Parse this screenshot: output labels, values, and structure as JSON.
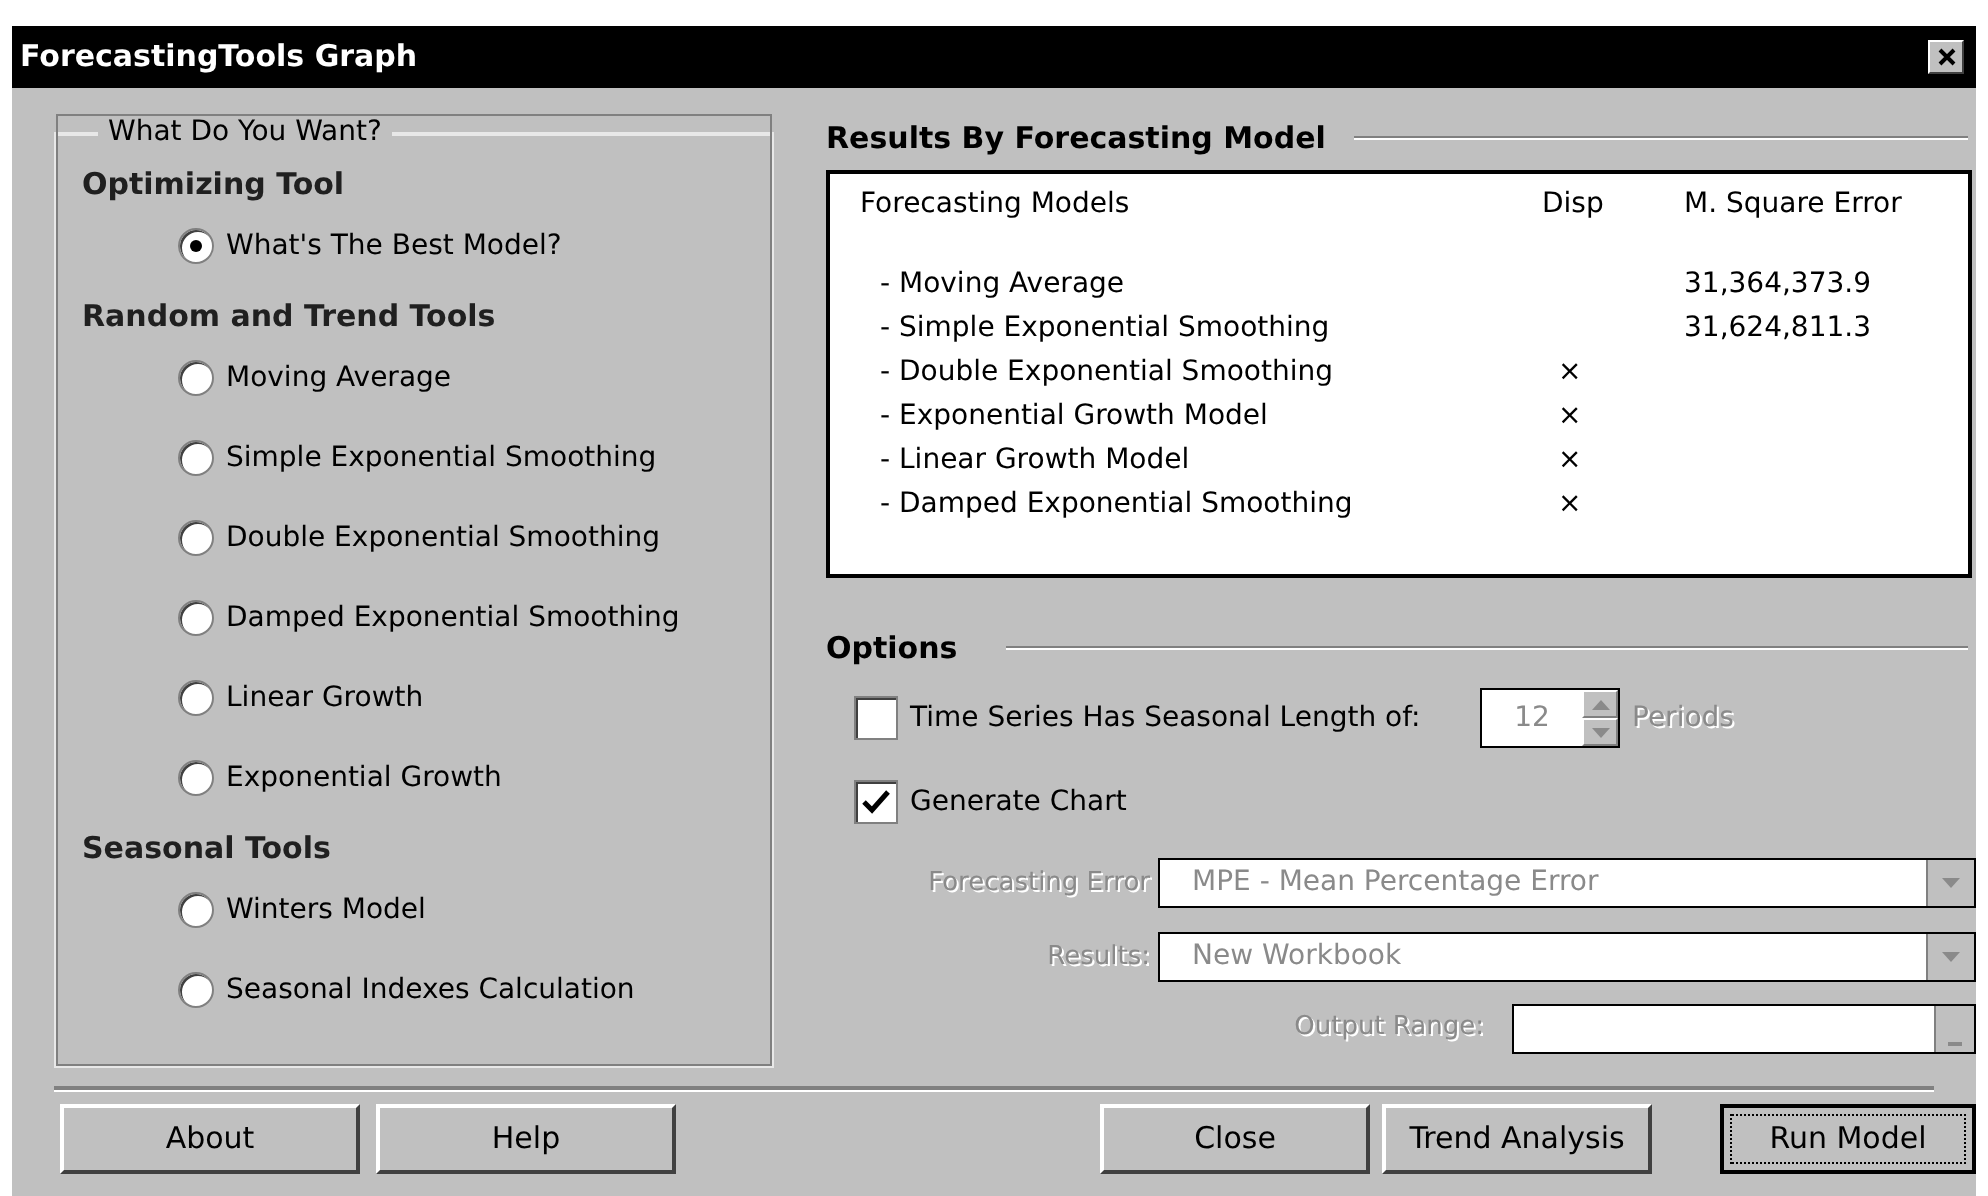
{
  "window": {
    "title": "ForecastingTools Graph"
  },
  "choice_group": {
    "title": "What Do You Want?",
    "sections": [
      {
        "heading": "Optimizing Tool",
        "options": [
          {
            "label": "What's The Best Model?",
            "selected": true
          }
        ]
      },
      {
        "heading": "Random and Trend Tools",
        "options": [
          {
            "label": "Moving Average",
            "selected": false
          },
          {
            "label": "Simple Exponential Smoothing",
            "selected": false
          },
          {
            "label": "Double Exponential Smoothing",
            "selected": false
          },
          {
            "label": "Damped Exponential Smoothing",
            "selected": false
          },
          {
            "label": "Linear Growth",
            "selected": false
          },
          {
            "label": "Exponential Growth",
            "selected": false
          }
        ]
      },
      {
        "heading": "Seasonal Tools",
        "options": [
          {
            "label": "Winters Model",
            "selected": false
          },
          {
            "label": "Seasonal Indexes Calculation",
            "selected": false
          }
        ]
      }
    ]
  },
  "results": {
    "title": "Results By Forecasting Model",
    "columns": [
      "Forecasting Models",
      "Disp",
      "M. Square Error"
    ],
    "rows": [
      {
        "model": "- Moving Average",
        "mse": "31,364,373.9"
      },
      {
        "model": "- Simple Exponential Smoothing",
        "mse": "31,624,811.3"
      },
      {
        "model": "- Double Exponential Smoothing",
        "disp": "×"
      },
      {
        "model": "- Exponential Growth Model",
        "disp": "×"
      },
      {
        "model": "- Linear Growth Model",
        "disp": "×"
      },
      {
        "model": "- Damped Exponential Smoothing",
        "disp": "×"
      }
    ]
  },
  "options": {
    "title": "Options",
    "seasonal": {
      "label": "Time Series Has Seasonal Length of:",
      "checked": false,
      "value": "12",
      "unit": "Periods",
      "disabled": true
    },
    "chart": {
      "label": "Generate Chart",
      "checked": true
    },
    "forecasting_error": {
      "label": "Forecasting Error",
      "value": "MPE  - Mean Percentage Error",
      "disabled": true
    },
    "results": {
      "label": "Results:",
      "value": "New Workbook",
      "disabled": true
    },
    "output_range": {
      "label": "Output Range:",
      "disabled": true
    }
  },
  "buttons_left": [
    {
      "label": "About",
      "default": false
    },
    {
      "label": "Help",
      "default": false
    }
  ],
  "buttons_right": [
    {
      "label": "Close",
      "default": false
    },
    {
      "label": "Trend Analysis",
      "default": false
    },
    {
      "label": "Run Model",
      "default": true
    }
  ]
}
